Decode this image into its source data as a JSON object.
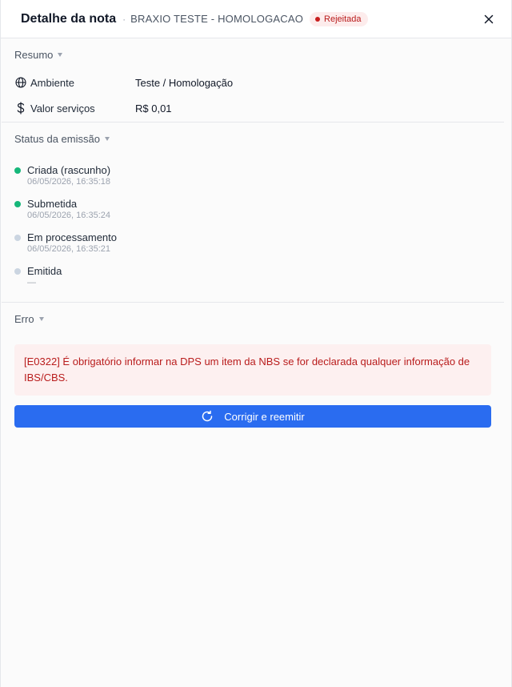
{
  "header": {
    "title": "Detalhe da nota",
    "separator": "·",
    "company": "BRAXIO TESTE - HOMOLOGACAO",
    "status_badge": "Rejeitada"
  },
  "summary": {
    "heading": "Resumo",
    "rows": [
      {
        "icon": "globe-icon",
        "label": "Ambiente",
        "value": "Teste / Homologação"
      },
      {
        "icon": "dollar-icon",
        "label": "Valor serviços",
        "value": "R$ 0,01"
      }
    ]
  },
  "emission_status": {
    "heading": "Status da emissão",
    "steps": [
      {
        "label": "Criada (rascunho)",
        "time": "06/05/2026, 16:35:18",
        "state": "done"
      },
      {
        "label": "Submetida",
        "time": "06/05/2026, 16:35:24",
        "state": "done"
      },
      {
        "label": "Em processamento",
        "time": "06/05/2026, 16:35:21",
        "state": "pending"
      },
      {
        "label": "Emitida",
        "time": "—",
        "state": "pending"
      }
    ]
  },
  "error": {
    "heading": "Erro",
    "message": "[E0322] É obrigatório informar na DPS um item da NBS se for declarada qualquer informação de IBS/CBS.",
    "action_label": "Corrigir e reemitir"
  },
  "colors": {
    "accent": "#2a6cf0",
    "error_text": "#b91c1c",
    "error_bg": "#fdf0f0",
    "done": "#16b77a",
    "pending": "#cbd5e1"
  }
}
